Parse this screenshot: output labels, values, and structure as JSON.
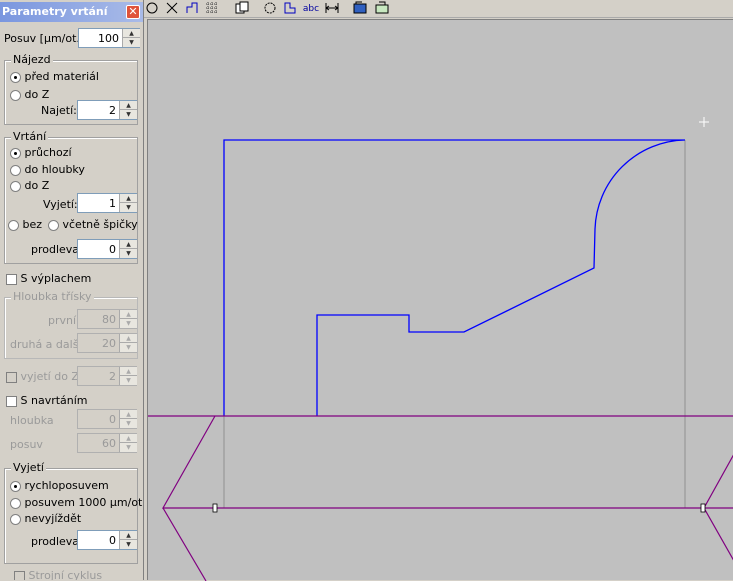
{
  "title": "Parametry vrtání",
  "posuv": {
    "label": "Posuv [µm/ot.]",
    "value": "100"
  },
  "najezd": {
    "title": "Nájezd",
    "options": [
      "před materiál",
      "do Z"
    ],
    "najeti_label": "Najetí:",
    "najeti_value": "2"
  },
  "vrtani": {
    "title": "Vrtání",
    "options": [
      "průchozí",
      "do hloubky",
      "do Z"
    ],
    "vyjeti_label": "Vyjetí:",
    "vyjeti_value": "1",
    "tip_bez": "bez",
    "tip_vcetne": "včetně špičky",
    "prodleva_label": "prodleva",
    "prodleva_value": "0"
  },
  "vyplach": {
    "label": "S výplachem",
    "hloubka_title": "Hloubka třísky",
    "prvni_label": "první",
    "prvni_value": "80",
    "druha_label": "druhá a další",
    "druha_value": "20",
    "vyjeti_do_z_label": "vyjetí do Z",
    "vyjeti_do_z_value": "2"
  },
  "navrtani": {
    "label": "S navrtáním",
    "hloubka_label": "hloubka",
    "hloubka_value": "0",
    "posuv_label": "posuv",
    "posuv_value": "60"
  },
  "vyjeti": {
    "title": "Vyjetí",
    "options": [
      "rychloposuvem",
      "posuvem 1000 µm/ot.",
      "nevyjíždět"
    ],
    "prodleva_label": "prodleva",
    "prodleva_value": "0"
  },
  "stroji_cyklus": "Strojní cyklus",
  "toolbar": {
    "icons": [
      "circle-tool-icon",
      "cross-tool-icon",
      "polyline-tool-icon",
      "grid-tool-icon",
      "copy-tool-icon",
      "rotate-tool-icon",
      "shape-tool-icon",
      "text-tool-icon",
      "dimension-tool-icon",
      "fill-tool-icon",
      "export-tool-icon"
    ],
    "text_icon_label": "abc"
  },
  "colors": {
    "part_contour": "#0000ff",
    "stock_outline": "#800080",
    "canvas_bg": "#c0c0c0"
  }
}
